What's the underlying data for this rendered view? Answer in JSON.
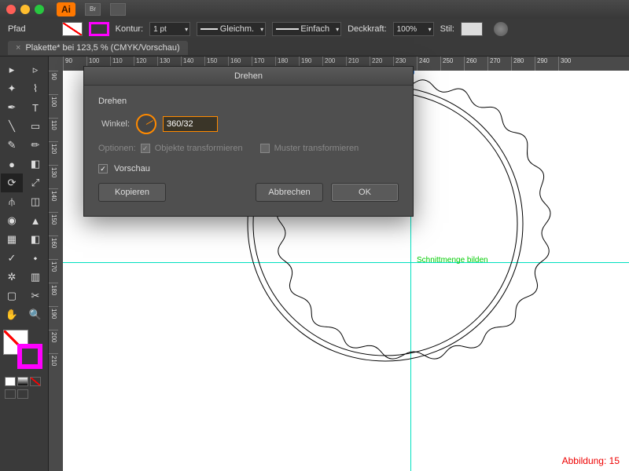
{
  "app": {
    "badge": "Ai"
  },
  "menubar": {
    "path_label": "Pfad",
    "kontur_label": "Kontur:",
    "kontur_value": "1 pt",
    "cap_label": "Gleichm.",
    "corner_label": "Einfach",
    "opacity_label": "Deckkraft:",
    "opacity_value": "100%",
    "style_label": "Stil:"
  },
  "tab": {
    "title": "Plakette* bei 123,5 % (CMYK/Vorschau)"
  },
  "ruler_h": [
    "90",
    "100",
    "110",
    "120",
    "130",
    "140",
    "150",
    "160",
    "170",
    "180",
    "190",
    "200",
    "210",
    "220",
    "230",
    "240",
    "250",
    "260",
    "270",
    "280",
    "290",
    "300"
  ],
  "ruler_v": [
    "90",
    "100",
    "110",
    "120",
    "130",
    "140",
    "150",
    "160",
    "170",
    "180",
    "190",
    "200",
    "210"
  ],
  "dialog": {
    "title": "Drehen",
    "group": "Drehen",
    "angle_label": "Winkel:",
    "angle_value": "360/32",
    "options_label": "Optionen:",
    "opt_transform_obj": "Objekte transformieren",
    "opt_transform_pattern": "Muster transformieren",
    "preview_label": "Vorschau",
    "btn_copy": "Kopieren",
    "btn_cancel": "Abbrechen",
    "btn_ok": "OK"
  },
  "smart_guide": "Schnittmenge bilden",
  "caption": "Abbildung: 15"
}
